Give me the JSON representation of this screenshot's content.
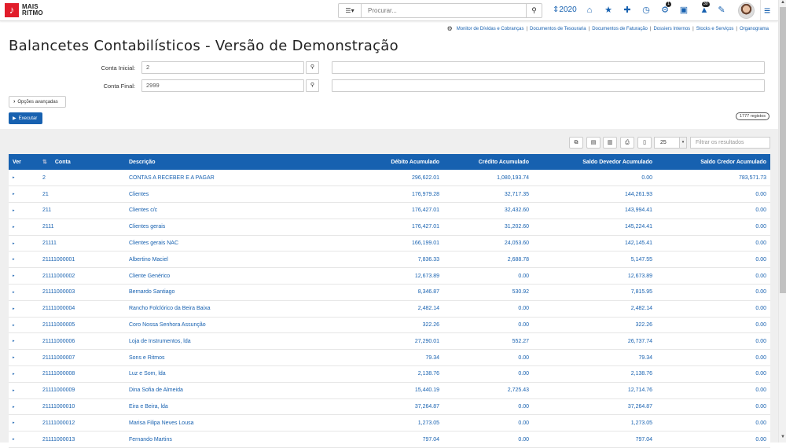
{
  "header": {
    "logo_glyph": "♪",
    "logo_line1": "MAIS",
    "logo_line2": "RITMO",
    "search_menu_icon": "☰▾",
    "search_placeholder": "Procurar...",
    "search_icon": "🔍",
    "year_icon": "⇕",
    "year": "2020",
    "icons": [
      {
        "name": "home-icon",
        "glyph": "⌂"
      },
      {
        "name": "star-icon",
        "glyph": "★"
      },
      {
        "name": "plus-icon",
        "glyph": "✚"
      },
      {
        "name": "clock-icon",
        "glyph": "◷"
      },
      {
        "name": "gears-icon",
        "glyph": "⚙",
        "badge": "1"
      },
      {
        "name": "calendar-icon",
        "glyph": "▣"
      },
      {
        "name": "bell-icon",
        "glyph": "▲",
        "badge": "30"
      },
      {
        "name": "wrench-icon",
        "glyph": "✎"
      }
    ],
    "menu_icon": "≡"
  },
  "quicklinks": {
    "gear": "⚙",
    "links": [
      "Monitor de Dívidas e Cobranças",
      "Documentos de Tesouraria",
      "Documentos de Faturação",
      "Dossiers Internos",
      "Stocks e Serviços",
      "Organograma"
    ],
    "separator": "|"
  },
  "page": {
    "title": "Balancetes Contabilísticos - Versão de Demonstração"
  },
  "form": {
    "conta_inicial_label": "Conta Inicial:",
    "conta_inicial_value": "2",
    "conta_final_label": "Conta Final:",
    "conta_final_value": "2999",
    "lookup_icon": "🔍",
    "advanced_chevron": "›",
    "advanced_label": "Opções avançadas",
    "execute_icon": "▶",
    "execute_label": "Executar"
  },
  "results": {
    "count_label": "1777 registos",
    "toolbar": [
      {
        "name": "copy-icon",
        "glyph": "⧉"
      },
      {
        "name": "excel-icon",
        "glyph": "▤"
      },
      {
        "name": "pdf-icon",
        "glyph": "▥"
      },
      {
        "name": "print-icon",
        "glyph": "⎙"
      },
      {
        "name": "columns-icon",
        "glyph": "▯"
      }
    ],
    "page_size": "25",
    "page_size_arrow": "▾",
    "filter_placeholder": "Filtrar os resultados"
  },
  "table": {
    "headers": [
      "Ver",
      "Conta",
      "Descrição",
      "Débito Acumulado",
      "Crédito Acumulado",
      "Saldo Devedor Acumulado",
      "Saldo Credor Acumulado"
    ],
    "sort_icon": "⇅",
    "expand_icon": "▸",
    "rows": [
      {
        "conta": "2",
        "descricao": "CONTAS A RECEBER E A PAGAR",
        "debito": "296,622.01",
        "credito": "1,080,193.74",
        "saldo_devedor": "0.00",
        "saldo_credor": "783,571.73"
      },
      {
        "conta": "21",
        "descricao": "Clientes",
        "debito": "176,979.28",
        "credito": "32,717.35",
        "saldo_devedor": "144,261.93",
        "saldo_credor": "0.00"
      },
      {
        "conta": "211",
        "descricao": "Clientes c/c",
        "debito": "176,427.01",
        "credito": "32,432.60",
        "saldo_devedor": "143,994.41",
        "saldo_credor": "0.00"
      },
      {
        "conta": "2111",
        "descricao": "Clientes gerais",
        "debito": "176,427.01",
        "credito": "31,202.60",
        "saldo_devedor": "145,224.41",
        "saldo_credor": "0.00"
      },
      {
        "conta": "21111",
        "descricao": "Clientes gerais NAC",
        "debito": "166,199.01",
        "credito": "24,053.60",
        "saldo_devedor": "142,145.41",
        "saldo_credor": "0.00"
      },
      {
        "conta": "21111000001",
        "descricao": "Albertino Maciel",
        "debito": "7,836.33",
        "credito": "2,688.78",
        "saldo_devedor": "5,147.55",
        "saldo_credor": "0.00"
      },
      {
        "conta": "21111000002",
        "descricao": "Cliente Genérico",
        "debito": "12,673.89",
        "credito": "0.00",
        "saldo_devedor": "12,673.89",
        "saldo_credor": "0.00"
      },
      {
        "conta": "21111000003",
        "descricao": "Bernardo Santiago",
        "debito": "8,346.87",
        "credito": "530.92",
        "saldo_devedor": "7,815.95",
        "saldo_credor": "0.00"
      },
      {
        "conta": "21111000004",
        "descricao": "Rancho Folclórico da Beira Baixa",
        "debito": "2,482.14",
        "credito": "0.00",
        "saldo_devedor": "2,482.14",
        "saldo_credor": "0.00"
      },
      {
        "conta": "21111000005",
        "descricao": "Coro Nossa Senhora Assunção",
        "debito": "322.26",
        "credito": "0.00",
        "saldo_devedor": "322.26",
        "saldo_credor": "0.00"
      },
      {
        "conta": "21111000006",
        "descricao": "Loja de Instrumentos, lda",
        "debito": "27,290.01",
        "credito": "552.27",
        "saldo_devedor": "26,737.74",
        "saldo_credor": "0.00"
      },
      {
        "conta": "21111000007",
        "descricao": "Sons e Ritmos",
        "debito": "79.34",
        "credito": "0.00",
        "saldo_devedor": "79.34",
        "saldo_credor": "0.00"
      },
      {
        "conta": "21111000008",
        "descricao": "Luz e Som, lda",
        "debito": "2,138.76",
        "credito": "0.00",
        "saldo_devedor": "2,138.76",
        "saldo_credor": "0.00"
      },
      {
        "conta": "21111000009",
        "descricao": "Dina Sofia de Almeida",
        "debito": "15,440.19",
        "credito": "2,725.43",
        "saldo_devedor": "12,714.76",
        "saldo_credor": "0.00"
      },
      {
        "conta": "21111000010",
        "descricao": "Eira e Beira, lda",
        "debito": "37,264.87",
        "credito": "0.00",
        "saldo_devedor": "37,264.87",
        "saldo_credor": "0.00"
      },
      {
        "conta": "21111000012",
        "descricao": "Marisa Filipa Neves Lousa",
        "debito": "1,273.05",
        "credito": "0.00",
        "saldo_devedor": "1,273.05",
        "saldo_credor": "0.00"
      },
      {
        "conta": "21111000013",
        "descricao": "Fernando Martins",
        "debito": "797.04",
        "credito": "0.00",
        "saldo_devedor": "797.04",
        "saldo_credor": "0.00"
      }
    ]
  },
  "colors": {
    "accent": "#1761b0",
    "logo_red": "#e11d2a"
  }
}
